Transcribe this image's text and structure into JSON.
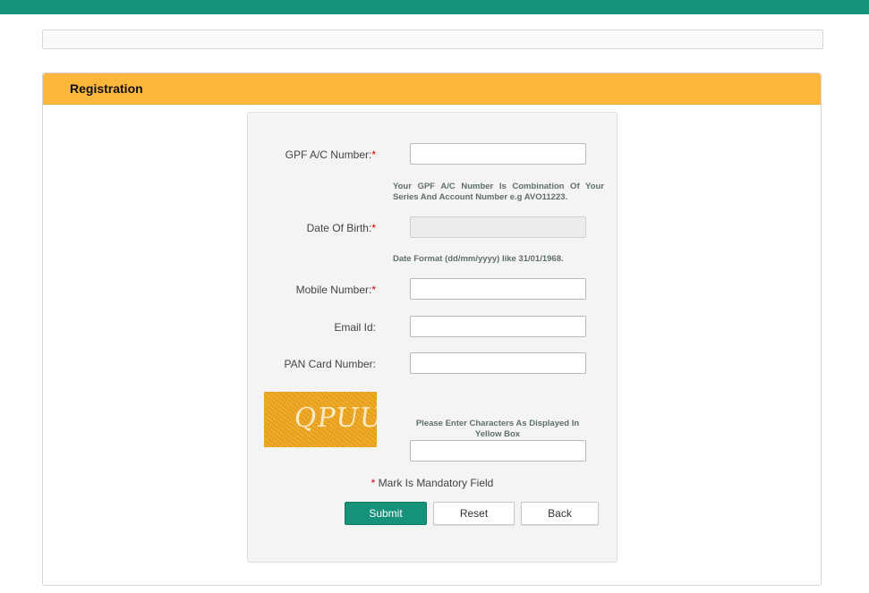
{
  "panel": {
    "title": "Registration"
  },
  "form": {
    "gpf": {
      "label": "GPF A/C Number:",
      "required_mark": "*",
      "value": "",
      "hint": "Your GPF A/C Number Is Combination Of Your Series And Account Number e.g AVO11223."
    },
    "dob": {
      "label": "Date Of Birth:",
      "required_mark": "*",
      "value": "",
      "hint": "Date Format (dd/mm/yyyy) like 31/01/1968."
    },
    "mobile": {
      "label": "Mobile Number:",
      "required_mark": "*",
      "value": ""
    },
    "email": {
      "label": "Email Id:",
      "value": ""
    },
    "pan": {
      "label": "PAN Card Number:",
      "value": ""
    },
    "captcha": {
      "image_text": "QPUU",
      "hint": "Please Enter Characters As Displayed In Yellow Box",
      "value": ""
    },
    "mandatory_mark": "*",
    "mandatory_note": " Mark Is Mandatory Field",
    "buttons": {
      "submit": "Submit",
      "reset": "Reset",
      "back": "Back"
    }
  },
  "colors": {
    "accent": "#16917a",
    "header": "#fbb73b",
    "required": "#cc0000"
  }
}
